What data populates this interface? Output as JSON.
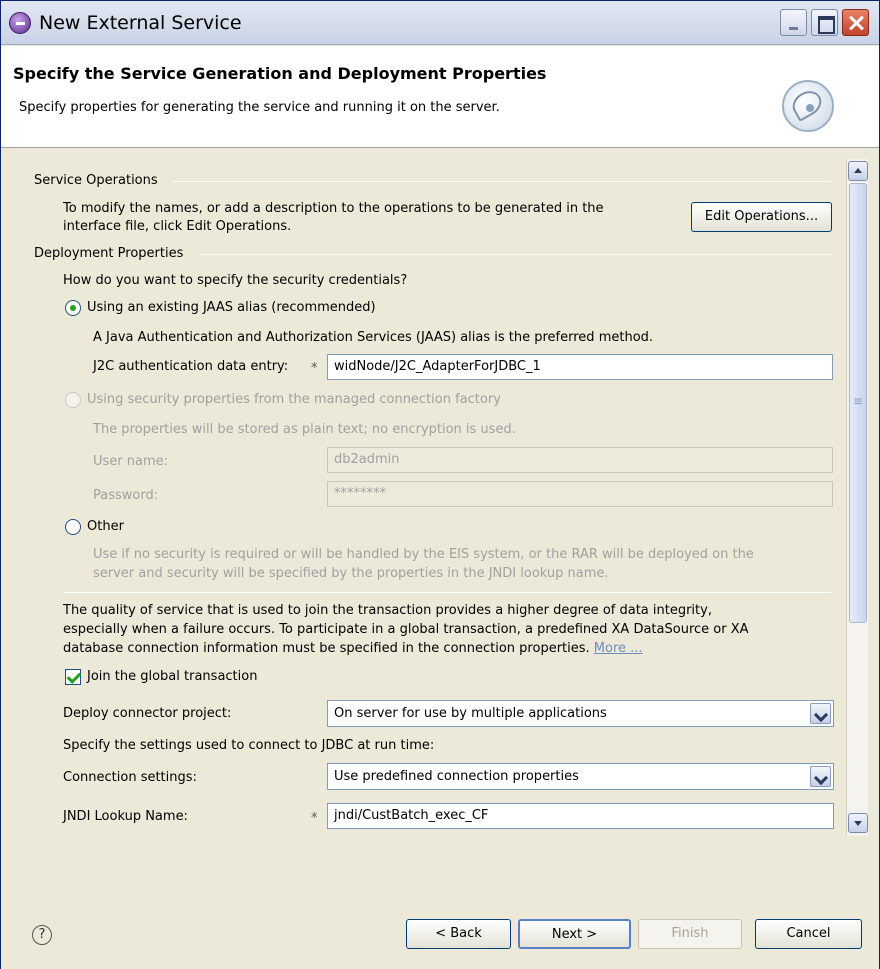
{
  "window": {
    "title": "New External Service"
  },
  "header": {
    "title": "Specify the Service Generation and Deployment Properties",
    "description": "Specify properties for generating the service and running it on the server."
  },
  "service_operations": {
    "section_label": "Service Operations",
    "description_line1": "To modify the names, or add a description to the operations to be generated in the",
    "description_line2": "interface file, click Edit Operations.",
    "edit_button": "Edit Operations..."
  },
  "deployment": {
    "section_label": "Deployment Properties",
    "question": "How do you want to specify the security credentials?",
    "jaas_option": "Using an existing JAAS alias (recommended)",
    "jaas_help": "A Java Authentication and Authorization Services (JAAS) alias is the preferred method.",
    "j2c_label": "J2C authentication data entry:",
    "j2c_value": "widNode/J2C_AdapterForJDBC_1",
    "security_option": "Using security properties from the managed connection factory",
    "security_help": "The properties will be stored as plain text; no encryption is used.",
    "username_label": "User name:",
    "username_value": "db2admin",
    "password_label": "Password:",
    "password_value": "********",
    "other_option": "Other",
    "other_help_line1": "Use if no security is required or will be handled by the EIS system, or the RAR will be deployed on the",
    "other_help_line2": "server and security will be specified by the properties in the JNDI lookup name.",
    "qos_line1": "The quality of service that is used to join the transaction provides a higher degree of data integrity,",
    "qos_line2": "especially when a failure occurs. To participate in a global transaction, a predefined XA DataSource or XA",
    "qos_line3": "database connection information must be specified in the connection properties.",
    "more_link": "More ...",
    "join_transaction": "Join the global transaction",
    "deploy_label": "Deploy connector project:",
    "deploy_value": "On server for use by multiple applications",
    "runtime_note": "Specify the settings used to connect to JDBC at run time:",
    "connection_label": "Connection settings:",
    "connection_value": "Use predefined connection properties",
    "jndi_label": "JNDI Lookup Name:",
    "jndi_value": "jndi/CustBatch_exec_CF",
    "required_marker": "*"
  },
  "footer": {
    "help": "?",
    "back": "< Back",
    "next": "Next >",
    "finish": "Finish",
    "cancel": "Cancel"
  }
}
